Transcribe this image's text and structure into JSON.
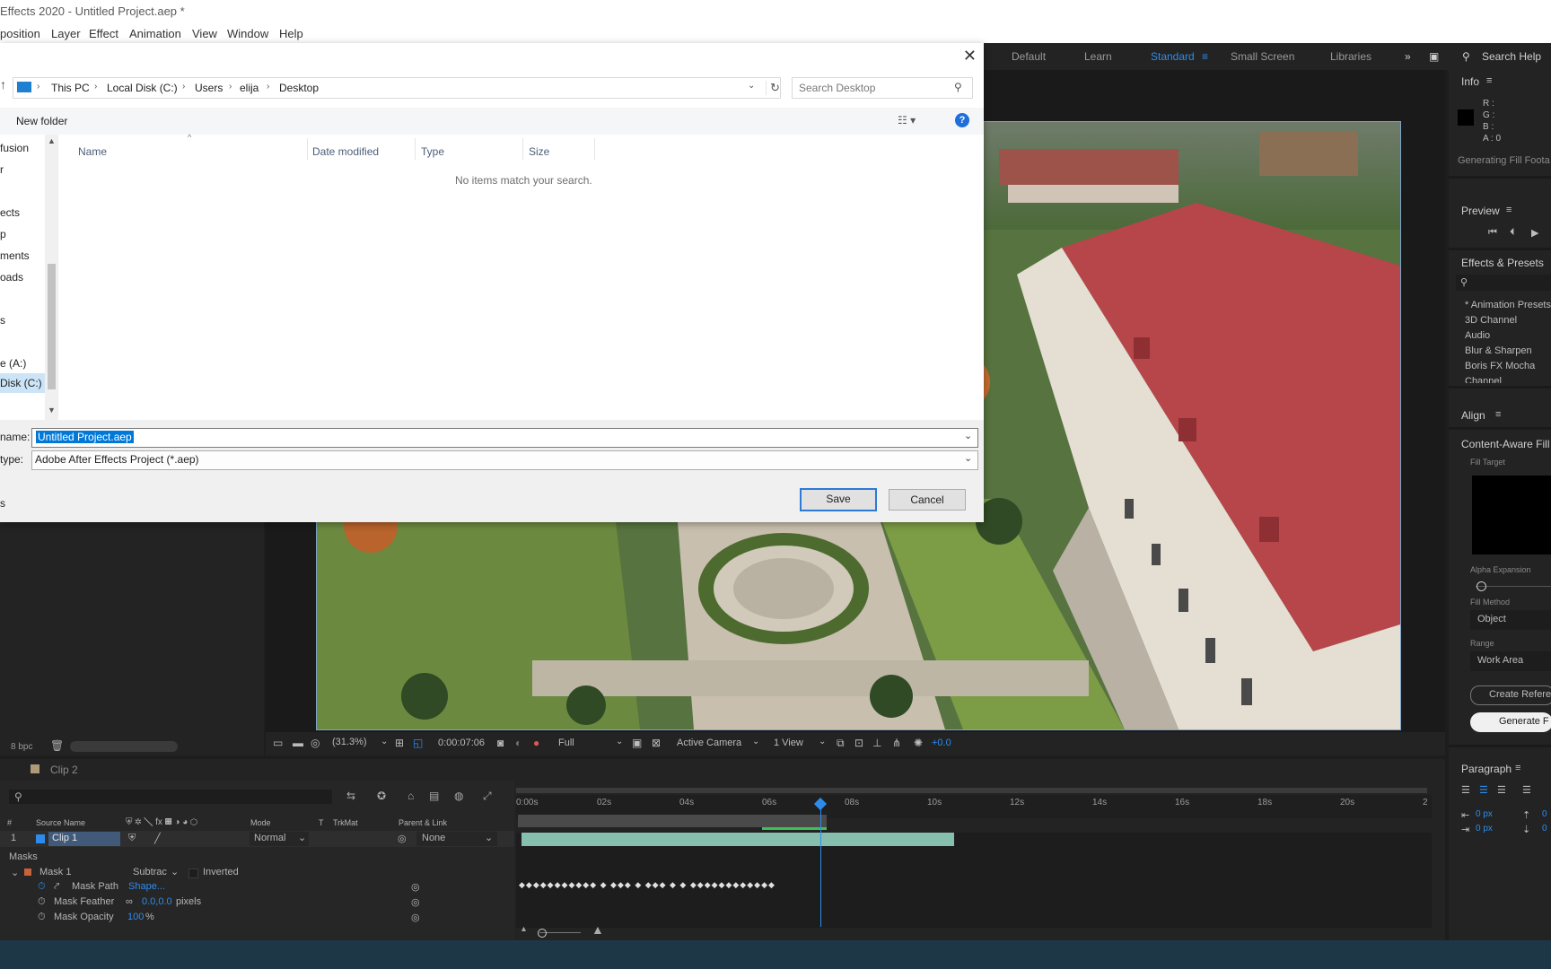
{
  "window": {
    "title": "Effects 2020 - Untitled Project.aep *"
  },
  "menu": [
    "position",
    "Layer",
    "Effect",
    "Animation",
    "View",
    "Window",
    "Help"
  ],
  "workspaces": {
    "items": [
      "Default",
      "Learn",
      "Standard",
      "Small Screen",
      "Libraries"
    ],
    "active": "Standard",
    "search_help": "Search Help"
  },
  "dialog": {
    "breadcrumbs": [
      "This PC",
      "Local Disk (C:)",
      "Users",
      "elija",
      "Desktop"
    ],
    "search_placeholder": "Search Desktop",
    "new_folder": "New folder",
    "nav_items": [
      "fusion",
      "r",
      "ects",
      "p",
      "ments",
      "oads",
      "s",
      "e (A:)",
      "Disk (C:)"
    ],
    "columns": [
      "Name",
      "Date modified",
      "Type",
      "Size"
    ],
    "empty_message": "No items match your search.",
    "file_name_label": "name:",
    "file_name_value": "Untitled Project.aep",
    "file_type_label": "type:",
    "file_type_value": "Adobe After Effects Project (*.aep)",
    "hide_folders_fragment": "s",
    "save": "Save",
    "cancel": "Cancel"
  },
  "viewer": {
    "zoom": "(31.3%)",
    "timecode": "0:00:07:06",
    "resolution": "Full",
    "camera": "Active Camera",
    "views": "1 View",
    "exposure": "+0.0"
  },
  "project": {
    "bpc": "8 bpc"
  },
  "info": {
    "title": "Info",
    "r": "R :",
    "g": "G :",
    "b": "B :",
    "a": "A : 0",
    "status": "Generating Fill Foota"
  },
  "preview": {
    "title": "Preview"
  },
  "effects": {
    "title": "Effects & Presets",
    "items": [
      "* Animation Presets",
      "3D Channel",
      "Audio",
      "Blur & Sharpen",
      "Boris FX Mocha",
      "Channel"
    ]
  },
  "align": {
    "title": "Align"
  },
  "caf": {
    "title": "Content-Aware Fill",
    "fill_target": "Fill Target",
    "alpha_expansion": "Alpha Expansion",
    "fill_method_label": "Fill Method",
    "fill_method": "Object",
    "range_label": "Range",
    "range": "Work Area",
    "create_ref": "Create Refere",
    "generate": "Generate F"
  },
  "paragraph": {
    "title": "Paragraph",
    "indent1": "0 px",
    "indent2": "0 px",
    "indent3": "0",
    "indent4": "0"
  },
  "timeline": {
    "comp_tab": "Clip 2",
    "columns": {
      "num": "#",
      "source": "Source Name",
      "mode": "Mode",
      "t": "T",
      "trkmat": "TrkMat",
      "parent": "Parent & Link"
    },
    "layer": {
      "index": "1",
      "name": "Clip 1",
      "mode": "Normal",
      "parent": "None"
    },
    "masks_label": "Masks",
    "mask": {
      "name": "Mask 1",
      "mode": "Subtrac",
      "inverted": "Inverted"
    },
    "mask_path": {
      "label": "Mask Path",
      "value": "Shape..."
    },
    "mask_feather": {
      "label": "Mask Feather",
      "value": "0.0,0.0",
      "unit": "pixels"
    },
    "mask_opacity": {
      "label": "Mask Opacity",
      "value": "100",
      "unit": "%"
    },
    "ruler": [
      "0:00s",
      "02s",
      "04s",
      "06s",
      "08s",
      "10s",
      "12s",
      "14s",
      "16s",
      "18s",
      "20s",
      "2"
    ]
  },
  "colors": {
    "accent": "#2d8ceb",
    "panel": "#232323",
    "clip_bar": "#86bfae",
    "dialog_select": "#0078d7"
  }
}
